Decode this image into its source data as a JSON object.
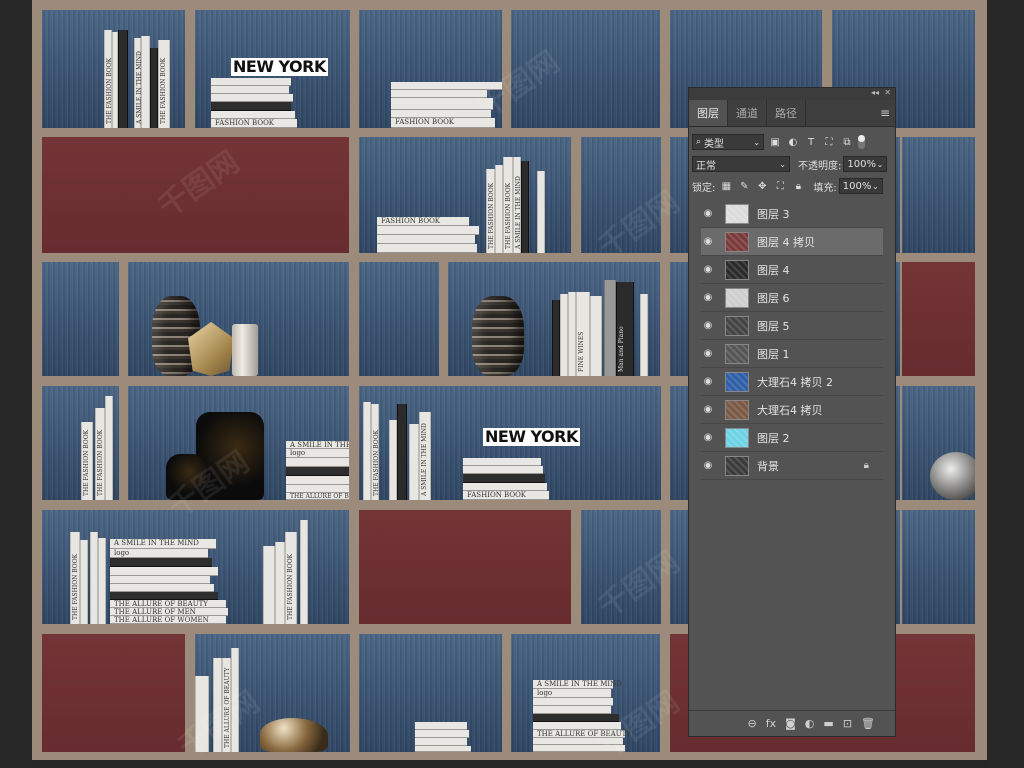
{
  "canvas": {
    "book_titles": {
      "new_york": "NEW YORK",
      "fashion_book": "THE FASHION BOOK",
      "fine_wines": "FINE WINES",
      "man_and_piano": "Man and Piano",
      "smile": "A SMILE IN THE MIND",
      "logo": "logo",
      "allure1": "THE ALLURE OF BEAUTY",
      "allure2": "THE ALLURE OF MEN",
      "allure3": "THE ALLURE OF WOMEN",
      "fashion_inverted": "FASHION BOOK"
    },
    "watermark": "千图网"
  },
  "layers_panel": {
    "collapse_label": "◂◂",
    "close_label": "✕",
    "tabs": [
      "图层",
      "通道",
      "路径"
    ],
    "active_tab": 0,
    "menu_icon": "≡",
    "filter": {
      "label": "类型",
      "icon": "search-icon"
    },
    "blend_mode": "正常",
    "opacity_label": "不透明度:",
    "opacity_value": "100%",
    "lock_label": "锁定:",
    "fill_label": "填充:",
    "fill_value": "100%",
    "layers": [
      {
        "name": "图层 3",
        "thumb": "#dcdcdc"
      },
      {
        "name": "图层 4 拷贝",
        "thumb": "#7a3a3a",
        "selected": true
      },
      {
        "name": "图层 4",
        "thumb": "#2a2a2a"
      },
      {
        "name": "图层 6",
        "thumb": "#cfcfcf"
      },
      {
        "name": "图层 5",
        "thumb": "#444444"
      },
      {
        "name": "图层 1",
        "thumb": "#555555"
      },
      {
        "name": "大理石4 拷贝 2",
        "thumb": "#2e5fa8"
      },
      {
        "name": "大理石4 拷贝",
        "thumb": "#7a5a44"
      },
      {
        "name": "图层 2",
        "thumb": "#6fd3e6"
      },
      {
        "name": "背景",
        "thumb": "#3b3b3b",
        "locked": true
      }
    ],
    "bottom_icons": [
      "link-icon",
      "fx-icon",
      "mask-icon",
      "adjustment-icon",
      "folder-icon",
      "new-layer-icon",
      "trash-icon"
    ],
    "bottom_glyphs": [
      "⊖",
      "fx",
      "◙",
      "◐",
      "▬",
      "⊡",
      "🗑"
    ]
  }
}
